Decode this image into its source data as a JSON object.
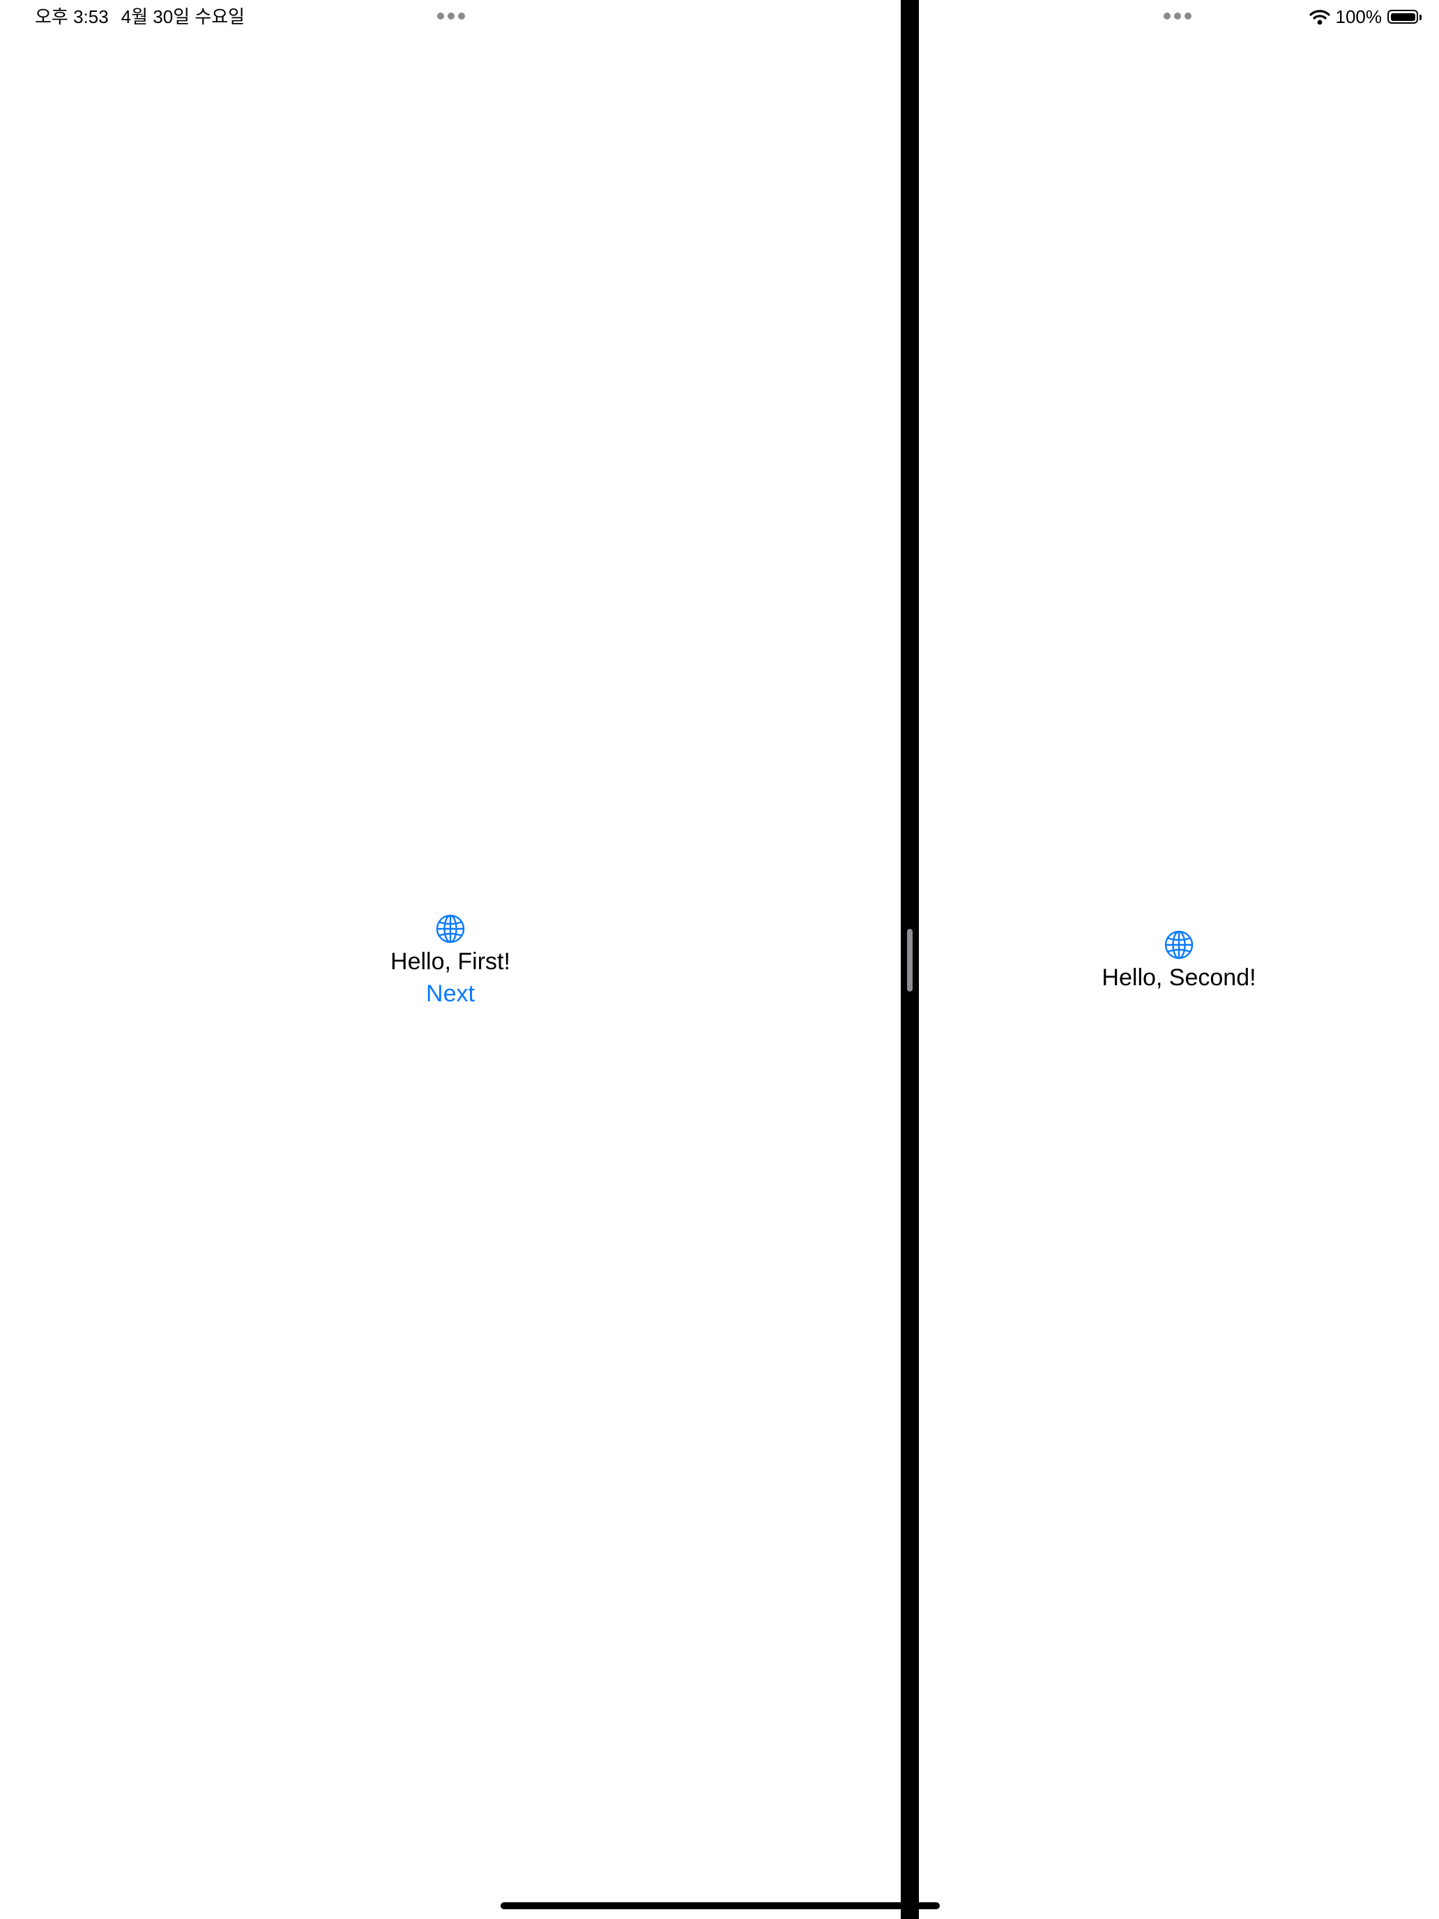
{
  "status_bar": {
    "time": "오후 3:53",
    "date": "4월 30일 수요일",
    "battery_percent": "100%",
    "battery_level": 1.0,
    "wifi_icon": "wifi-icon",
    "battery_icon": "battery-icon"
  },
  "first_scene": {
    "icon": "globe-icon",
    "greeting": "Hello, First!",
    "next_label": "Next"
  },
  "second_scene": {
    "icon": "globe-icon",
    "greeting": "Hello, Second!"
  },
  "colors": {
    "accent": "#0a7aff",
    "divider": "#000000",
    "background": "#ffffff"
  }
}
